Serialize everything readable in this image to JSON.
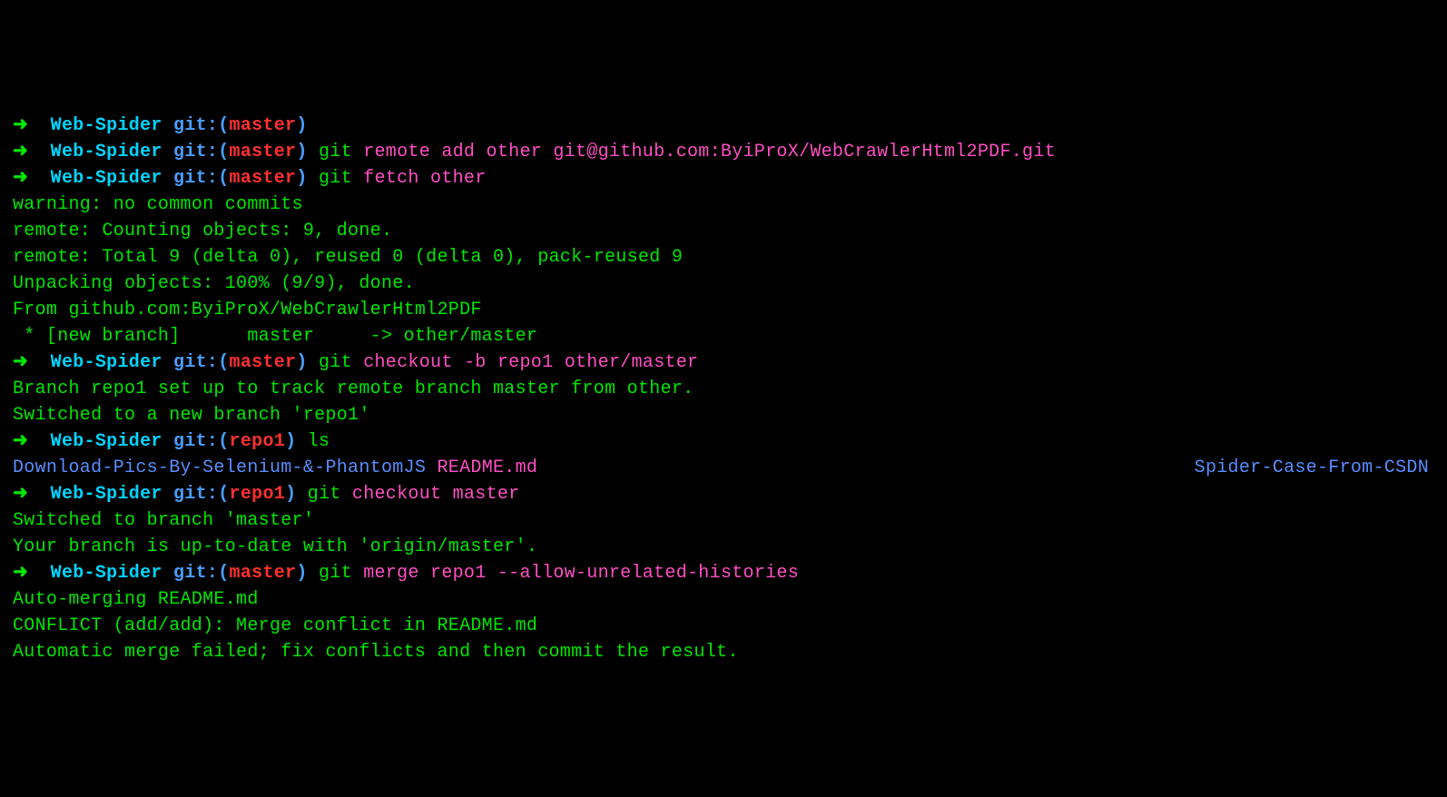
{
  "prompt": {
    "arrow": "➜",
    "dir": "Web-Spider",
    "gitLabel": "git:",
    "branchMaster": "master",
    "branchRepo1": "repo1"
  },
  "lines": [
    {
      "type": "prompt",
      "branch": "master",
      "cmd": ""
    },
    {
      "type": "prompt",
      "branch": "master",
      "cmd": "git remote add other git@github.com:ByiProX/WebCrawlerHtml2PDF.git",
      "cmdParts": [
        {
          "t": "git",
          "c": "green"
        },
        {
          "t": " ",
          "c": "plain"
        },
        {
          "t": "remote",
          "c": "magenta"
        },
        {
          "t": " ",
          "c": "plain"
        },
        {
          "t": "add",
          "c": "magenta"
        },
        {
          "t": " ",
          "c": "plain"
        },
        {
          "t": "other",
          "c": "magenta"
        },
        {
          "t": " ",
          "c": "plain"
        },
        {
          "t": "git@github.com:ByiProX/WebCrawlerHtml2PDF.git",
          "c": "magenta"
        }
      ]
    },
    {
      "type": "prompt",
      "branch": "master",
      "cmd": "git fetch other",
      "cmdParts": [
        {
          "t": "git",
          "c": "green"
        },
        {
          "t": " ",
          "c": "plain"
        },
        {
          "t": "fetch",
          "c": "magenta"
        },
        {
          "t": " ",
          "c": "plain"
        },
        {
          "t": "other",
          "c": "magenta"
        }
      ]
    },
    {
      "type": "out",
      "text": "warning: no common commits"
    },
    {
      "type": "out",
      "text": "remote: Counting objects: 9, done."
    },
    {
      "type": "out",
      "text": "remote: Total 9 (delta 0), reused 0 (delta 0), pack-reused 9"
    },
    {
      "type": "out",
      "text": "Unpacking objects: 100% (9/9), done."
    },
    {
      "type": "out",
      "text": "From github.com:ByiProX/WebCrawlerHtml2PDF"
    },
    {
      "type": "out",
      "text": " * [new branch]      master     -> other/master"
    },
    {
      "type": "prompt",
      "branch": "master",
      "cmd": "git checkout -b repo1 other/master",
      "cmdParts": [
        {
          "t": "git",
          "c": "green"
        },
        {
          "t": " ",
          "c": "plain"
        },
        {
          "t": "checkout",
          "c": "magenta"
        },
        {
          "t": " ",
          "c": "plain"
        },
        {
          "t": "-b",
          "c": "magenta"
        },
        {
          "t": " ",
          "c": "plain"
        },
        {
          "t": "repo1",
          "c": "magenta"
        },
        {
          "t": " ",
          "c": "plain"
        },
        {
          "t": "other/master",
          "c": "magenta"
        }
      ]
    },
    {
      "type": "out",
      "text": "Branch repo1 set up to track remote branch master from other."
    },
    {
      "type": "out",
      "text": "Switched to a new branch 'repo1'"
    },
    {
      "type": "prompt",
      "branch": "repo1",
      "cmd": "ls",
      "cmdParts": [
        {
          "t": "ls",
          "c": "green"
        }
      ]
    },
    {
      "type": "ls",
      "left": "Download-Pics-By-Selenium-&-PhantomJS",
      "mid": "README.md",
      "right": "Spider-Case-From-CSDN"
    },
    {
      "type": "prompt",
      "branch": "repo1",
      "cmd": "git checkout master",
      "cmdParts": [
        {
          "t": "git",
          "c": "green"
        },
        {
          "t": " ",
          "c": "plain"
        },
        {
          "t": "checkout",
          "c": "magenta"
        },
        {
          "t": " ",
          "c": "plain"
        },
        {
          "t": "master",
          "c": "magenta"
        }
      ]
    },
    {
      "type": "out",
      "text": "Switched to branch 'master'"
    },
    {
      "type": "out",
      "text": "Your branch is up-to-date with 'origin/master'."
    },
    {
      "type": "prompt",
      "branch": "master",
      "cmd": "git merge repo1 --allow-unrelated-histories",
      "cmdParts": [
        {
          "t": "git",
          "c": "green"
        },
        {
          "t": " ",
          "c": "plain"
        },
        {
          "t": "merge",
          "c": "magenta"
        },
        {
          "t": " ",
          "c": "plain"
        },
        {
          "t": "repo1",
          "c": "magenta"
        },
        {
          "t": " ",
          "c": "plain"
        },
        {
          "t": "--allow-unrelated-histories",
          "c": "magenta"
        }
      ]
    },
    {
      "type": "out",
      "text": "Auto-merging README.md"
    },
    {
      "type": "out",
      "text": "CONFLICT (add/add): Merge conflict in README.md"
    },
    {
      "type": "out",
      "text": "Automatic merge failed; fix conflicts and then commit the result."
    }
  ]
}
